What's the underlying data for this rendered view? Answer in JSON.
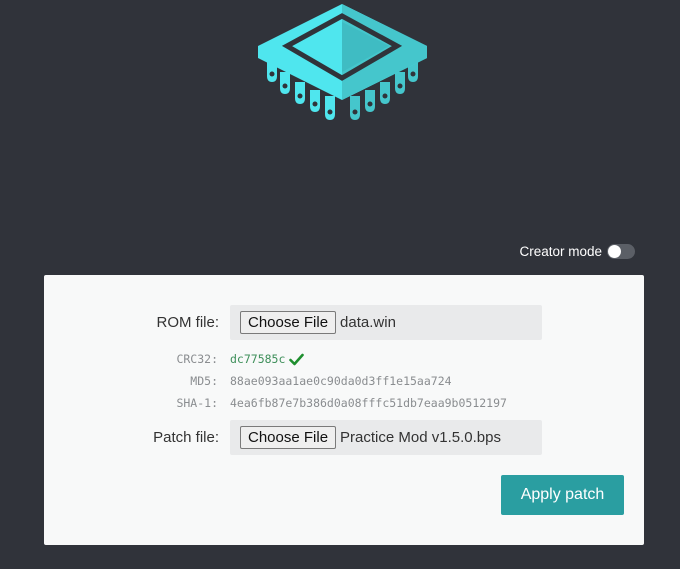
{
  "header": {
    "logo_icon": "chip-icon",
    "creator_mode_label": "Creator mode",
    "creator_mode_enabled": false
  },
  "form": {
    "rom": {
      "label": "ROM file:",
      "button_label": "Choose File",
      "file_name": "data.win"
    },
    "hashes": [
      {
        "label": "CRC32:",
        "value": "dc77585c",
        "verified": true
      },
      {
        "label": "MD5:",
        "value": "88ae093aa1ae0c90da0d3ff1e15aa724"
      },
      {
        "label": "SHA-1:",
        "value": "4ea6fb87e7b386d0a08fffc51db7eaa9b0512197"
      }
    ],
    "patch": {
      "label": "Patch file:",
      "button_label": "Choose File",
      "file_name": "Practice Mod v1.5.0.bps"
    },
    "apply_label": "Apply patch"
  },
  "colors": {
    "background": "#30333a",
    "accent": "#2a9ea1",
    "logo": "#4fe6ee",
    "verified": "#1f8f2f"
  }
}
